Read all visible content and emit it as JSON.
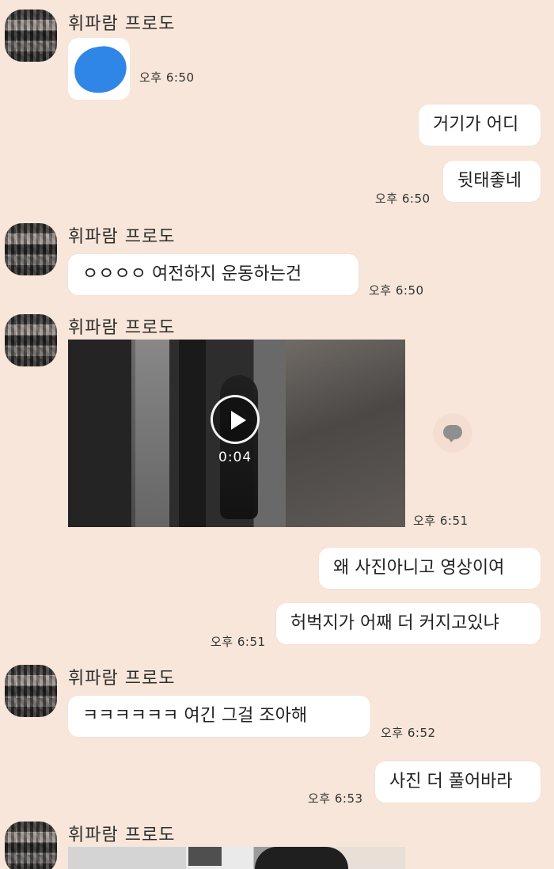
{
  "chat": {
    "sender_name": "휘파람 프로도",
    "emoji_color": "#2f86e6",
    "messages": [
      {
        "sender": "휘파람 프로도",
        "time": "오후 6:50",
        "type": "emoji"
      },
      {
        "sender": "me",
        "text": "거기가 어디",
        "type": "text"
      },
      {
        "sender": "me",
        "text": "뒷태좋네",
        "time": "오후 6:50",
        "type": "text"
      },
      {
        "sender": "휘파람 프로도",
        "text": "ㅇㅇㅇㅇ 여전하지 운동하는건",
        "time": "오후 6:50",
        "type": "text"
      },
      {
        "sender": "휘파람 프로도",
        "time": "오후 6:51",
        "type": "video",
        "duration": "0:04"
      },
      {
        "sender": "me",
        "text": "왜 사진아니고 영상이여",
        "type": "text"
      },
      {
        "sender": "me",
        "text": "허벅지가 어째 더 커지고있냐",
        "time": "오후 6:51",
        "type": "text"
      },
      {
        "sender": "휘파람 프로도",
        "text": "ㅋㅋㅋㅋㅋㅋ 여긴 그걸 조아해",
        "time": "오후 6:52",
        "type": "text"
      },
      {
        "sender": "me",
        "text": "사진 더 풀어바라",
        "time": "오후 6:53",
        "type": "text"
      },
      {
        "sender": "휘파람 프로도",
        "type": "image"
      }
    ]
  }
}
